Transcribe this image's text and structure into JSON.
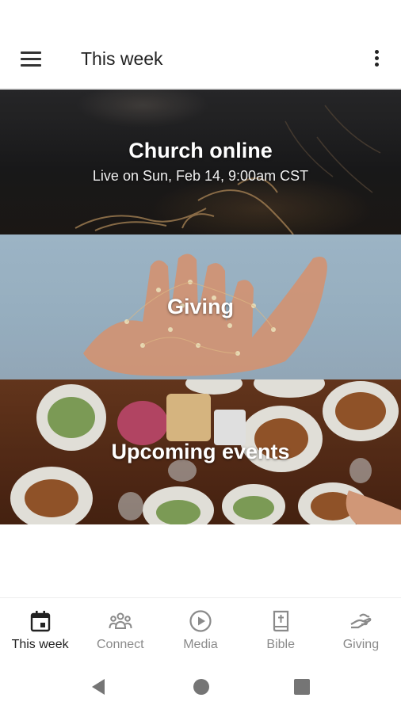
{
  "app_bar": {
    "title": "This week",
    "menu_icon": "hamburger-menu-icon",
    "overflow_icon": "more-vert-icon"
  },
  "cards": [
    {
      "title": "Church online",
      "subtitle": "Live on Sun, Feb 14, 9:00am CST"
    },
    {
      "title": "Giving",
      "subtitle": ""
    },
    {
      "title": "Upcoming events",
      "subtitle": ""
    }
  ],
  "bottom_nav": {
    "active_index": 0,
    "items": [
      {
        "label": "This week",
        "icon": "calendar-icon"
      },
      {
        "label": "Connect",
        "icon": "people-group-icon"
      },
      {
        "label": "Media",
        "icon": "play-circle-icon"
      },
      {
        "label": "Bible",
        "icon": "bible-book-icon"
      },
      {
        "label": "Giving",
        "icon": "giving-hand-icon"
      }
    ]
  },
  "colors": {
    "active": "#222222",
    "inactive": "#8a8a8a",
    "system_nav": "#757575"
  }
}
